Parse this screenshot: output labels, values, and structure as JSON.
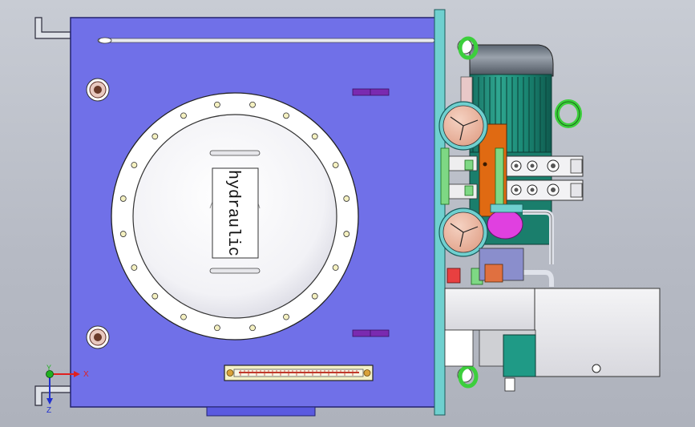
{
  "label_text": "hydraulic",
  "triad": {
    "x_label": "X",
    "y_label": "Y",
    "z_label": "Z"
  },
  "colors": {
    "background": "#b9bdc6",
    "tank": "#7070e8",
    "tank_border": "#23236e",
    "flange": "#ffffff",
    "panel": "#6fd0cf",
    "motor": "#1f8f7d",
    "valve_orange": "#e06a12",
    "fitting_green": "#7ed884",
    "triad_x": "#e02020",
    "triad_y": "#20b020",
    "triad_z": "#2030d0"
  }
}
